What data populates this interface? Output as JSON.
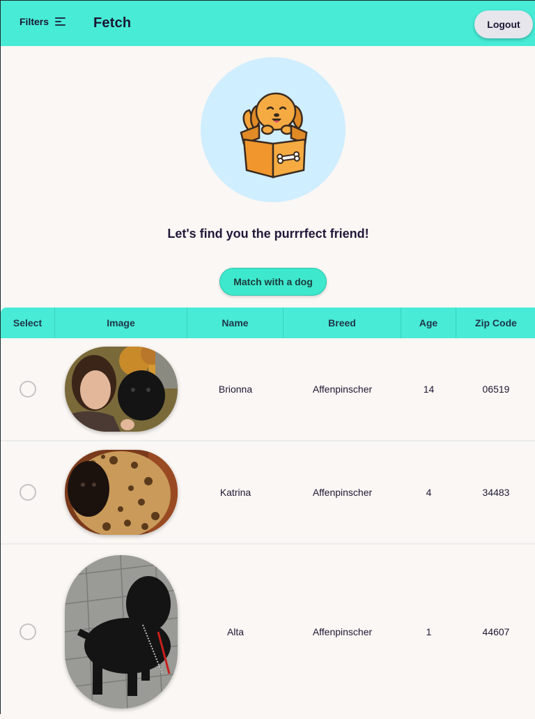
{
  "header": {
    "filters_label": "Filters",
    "filters_icon": "filter-lines-icon",
    "brand": "Fetch",
    "logout_label": "Logout",
    "accent_color": "#47ebd6"
  },
  "hero": {
    "illustration": "dog-in-box-illustration",
    "tagline": "Let's find you the purrrfect friend!",
    "match_button": "Match with a dog"
  },
  "table": {
    "columns": [
      "Select",
      "Image",
      "Name",
      "Breed",
      "Age",
      "Zip Code"
    ],
    "rows": [
      {
        "name": "Brionna",
        "breed": "Affenpinscher",
        "age": "14",
        "zip": "06519",
        "selected": false,
        "image": "woman-with-black-dog-photo"
      },
      {
        "name": "Katrina",
        "breed": "Affenpinscher",
        "age": "4",
        "zip": "34483",
        "selected": false,
        "image": "dog-in-leopard-bed-photo"
      },
      {
        "name": "Alta",
        "breed": "Affenpinscher",
        "age": "1",
        "zip": "44607",
        "selected": false,
        "image": "black-dog-on-pavement-photo"
      }
    ]
  }
}
